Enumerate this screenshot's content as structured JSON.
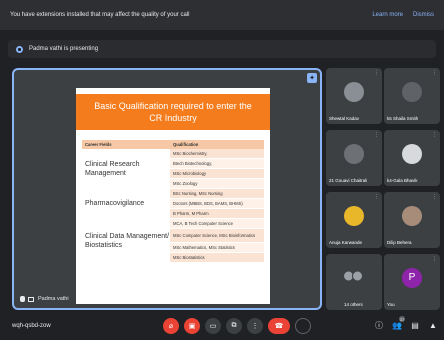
{
  "banner": {
    "message": "You have extensions installed that may affect the quality of your call",
    "learn_more": "Learn more",
    "dismiss": "Dismiss"
  },
  "presenting_bar": {
    "text": "Padma vathi is presenting"
  },
  "slide": {
    "title_line1": "Basic Qualification required to enter the",
    "title_line2": "CR Industry",
    "col_field": "Career Fields",
    "col_qual": "Qualification",
    "groups": [
      {
        "field": "Clinical Research Management",
        "quals": [
          "MSc Biochemistry,",
          "Btech Biotechnology,",
          "MSc Microbiology",
          "MSc Zoology"
        ]
      },
      {
        "field": "Pharmacovigilance",
        "quals": [
          "BSc Nursing, MSc Nursing",
          "Doctors (MBBS, BDS, BAMS, BHMS)",
          "B Pharm, M Pharm"
        ]
      },
      {
        "field": "Clinical Data Management/ Biostatistics",
        "quals": [
          "MCA, B Tech Computer Science",
          "MSc Computer Science, MSc Bioinformatics",
          "MSc Mathematics, MSc Statistics",
          "MSc Biostatistics"
        ]
      }
    ]
  },
  "presenter_name": "Padma vathi",
  "participants": [
    {
      "name": "Shewtal Kadav",
      "kind": "photo"
    },
    {
      "name": "k5 Shaila Smith",
      "kind": "photo"
    },
    {
      "name": "21 Gouavi Chaitrali",
      "kind": "photo"
    },
    {
      "name": "k4-Gala Bhavik",
      "kind": "photo"
    },
    {
      "name": "Anuja Karwande",
      "kind": "photo"
    },
    {
      "name": "Dilip Behera",
      "kind": "photo"
    },
    {
      "name": "14 others",
      "kind": "group"
    },
    {
      "name": "You",
      "kind": "letter",
      "letter": "P"
    }
  ],
  "meeting_code": "wqh-qsbd-zow",
  "people_count": "37",
  "colors": {
    "accent": "#8ab4f8",
    "danger": "#ea4335",
    "slide_orange": "#f47c1c"
  }
}
